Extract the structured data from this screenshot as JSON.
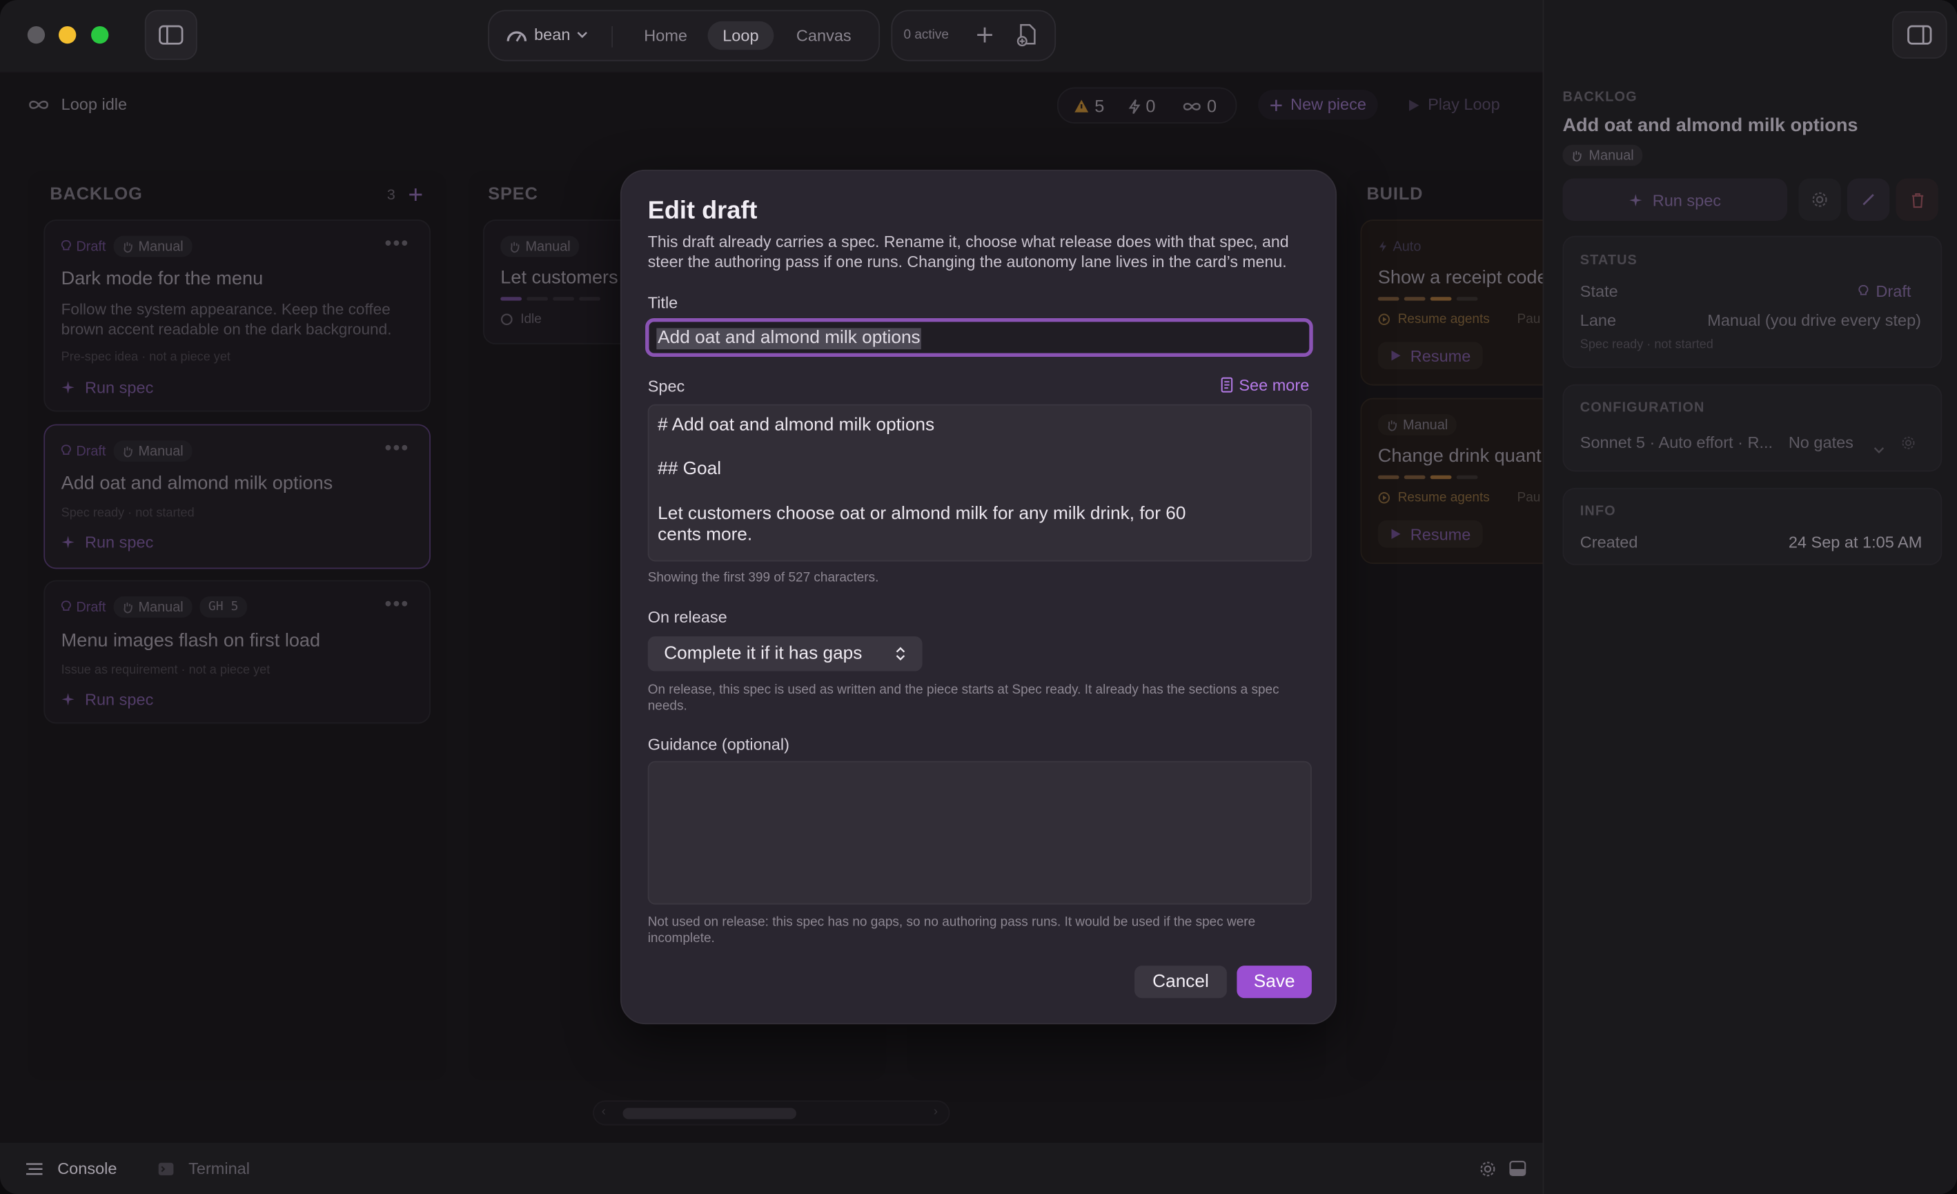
{
  "topbar": {
    "workspace": "bean",
    "tabs": [
      {
        "label": "Home"
      },
      {
        "label": "Loop"
      },
      {
        "label": "Canvas"
      }
    ],
    "active_count": "0 active"
  },
  "subbar": {
    "loop_status": "Loop idle",
    "warnings": "5",
    "bolts": "0",
    "loops": "0",
    "new_piece": "New piece",
    "play_loop": "Play Loop"
  },
  "board": {
    "backlog": {
      "title": "BACKLOG",
      "count": "3",
      "cards": [
        {
          "status": "Draft",
          "lane": "Manual",
          "title": "Dark mode for the menu",
          "desc": "Follow the system appearance. Keep the coffee brown accent readable on the dark background.",
          "meta": "Pre-spec idea · not a piece yet",
          "action": "Run spec"
        },
        {
          "status": "Draft",
          "lane": "Manual",
          "title": "Add oat and almond milk options",
          "meta": "Spec ready · not started",
          "action": "Run spec"
        },
        {
          "status": "Draft",
          "lane": "Manual",
          "tag": "GH 5",
          "title": "Menu images flash on first load",
          "meta": "Issue as requirement · not a piece yet",
          "action": "Run spec"
        }
      ]
    },
    "spec": {
      "title": "SPEC",
      "card": {
        "lane": "Manual",
        "title": "Let customers",
        "state": "Idle"
      }
    },
    "build": {
      "title": "BUILD",
      "cards": [
        {
          "lane": "Auto",
          "title": "Show a receipt code",
          "agents": "Resume agents",
          "tail": "Pau",
          "action": "Resume"
        },
        {
          "lane": "Manual",
          "title": "Change drink quant",
          "agents": "Resume agents",
          "tail": "Pau",
          "action": "Resume"
        }
      ]
    }
  },
  "panel": {
    "column": "BACKLOG",
    "title": "Add oat and almond milk options",
    "lane_chip": "Manual",
    "run_spec": "Run spec",
    "status_label": "STATUS",
    "state_label": "State",
    "state_value": "Draft",
    "lane_label": "Lane",
    "lane_value": "Manual (you drive every step)",
    "spec_meta": "Spec ready · not started",
    "config_label": "CONFIGURATION",
    "config_value": "Sonnet 5 · Auto effort · R...",
    "gates": "No gates",
    "info_label": "INFO",
    "created_label": "Created",
    "created_value": "24 Sep at 1:05 AM"
  },
  "bottom": {
    "console": "Console",
    "terminal": "Terminal"
  },
  "modal": {
    "heading": "Edit draft",
    "subtitle": "This draft already carries a spec. Rename it, choose what release does with that spec, and steer the authoring pass if one runs. Changing the autonomy lane lives in the card’s menu.",
    "title_label": "Title",
    "title_value": "Add oat and almond milk options",
    "spec_label": "Spec",
    "see_more": "See more",
    "spec_lines": [
      "# Add oat and almond milk options",
      "## Goal",
      "Let customers choose oat or almond milk for any milk drink, for 60",
      "cents more."
    ],
    "spec_hint": "Showing the first 399 of 527 characters.",
    "release_label": "On release",
    "release_value": "Complete it if it has gaps",
    "release_hint": "On release, this spec is used as written and the piece starts at Spec ready. It already has the sections a spec needs.",
    "guidance_label": "Guidance (optional)",
    "guidance_value": "",
    "guidance_hint": "Not used on release: this spec has no gaps, so no authoring pass runs. It would be used if the spec were incomplete.",
    "cancel": "Cancel",
    "save": "Save"
  },
  "colors": {
    "accent": "#9a4fd2",
    "accent_text": "#b67be9",
    "focus_ring": "#8a53b4",
    "warning": "#d19a3a",
    "modal_bg": "#2a2630"
  }
}
